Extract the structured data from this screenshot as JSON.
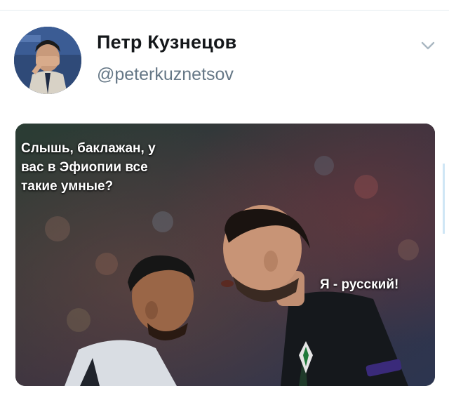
{
  "tweet": {
    "author": {
      "display_name": "Петр Кузнецов",
      "handle": "@peterkuznetsov",
      "avatar_icon": "person-facepalm-avatar"
    },
    "menu_icon": "chevron-down-icon",
    "media": {
      "caption_left": "Слышь, баклажан, у\nвас в Эфиопии все\nтакие умные?",
      "caption_right": "Я - русский!"
    }
  },
  "colors": {
    "name": "#14171a",
    "handle": "#657786",
    "divider": "#e6ecf0",
    "chevron": "#aab8c2"
  }
}
